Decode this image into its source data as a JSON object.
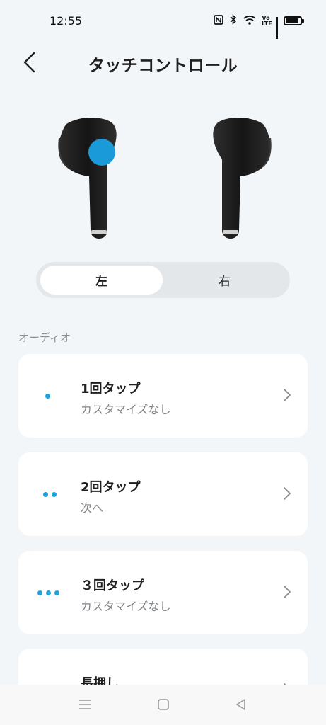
{
  "status_bar": {
    "time": "12:55",
    "icons": [
      "nfc-icon",
      "bluetooth-icon",
      "wifi-icon",
      "volte-icon",
      "signal-icon",
      "battery-icon"
    ],
    "volte_text": "Vo LTE"
  },
  "header": {
    "title": "タッチコントロール"
  },
  "side_toggle": {
    "left_label": "左",
    "right_label": "右",
    "selected": "左"
  },
  "section": {
    "label": "オーディオ"
  },
  "controls": [
    {
      "title": "1回タップ",
      "subtitle": "カスタマイズなし",
      "dots": 1
    },
    {
      "title": "2回タップ",
      "subtitle": "次へ",
      "dots": 2
    },
    {
      "title": "３回タップ",
      "subtitle": "カスタマイズなし",
      "dots": 3
    },
    {
      "title": "長押し",
      "subtitle": "",
      "dots": 0
    }
  ],
  "colors": {
    "accent": "#1aa3dc",
    "background": "#f3f6f9",
    "card": "#ffffff"
  }
}
